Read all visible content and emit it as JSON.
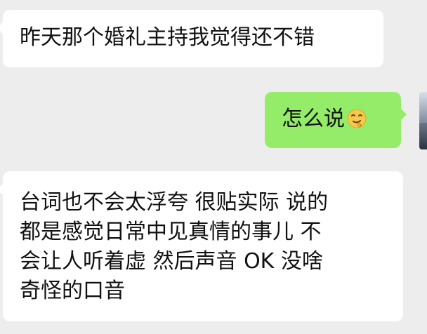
{
  "chat": {
    "messages": [
      {
        "side": "incoming",
        "text": "昨天那个婚礼主持我觉得还不错"
      },
      {
        "side": "outgoing",
        "text": "怎么说",
        "emoji": "thinking-emoji"
      },
      {
        "side": "incoming",
        "lines": [
          "台词也不会太浮夸  很贴实际  说的",
          "都是感觉日常中见真情的事儿 不",
          "会让人听着虚  然后声音 OK 没啥",
          "奇怪的口音"
        ]
      }
    ],
    "avatar_icon": "profile-avatar",
    "colors": {
      "background": "#ededed",
      "incoming_bubble": "#ffffff",
      "outgoing_bubble": "#95ec69",
      "text": "#111111"
    }
  }
}
